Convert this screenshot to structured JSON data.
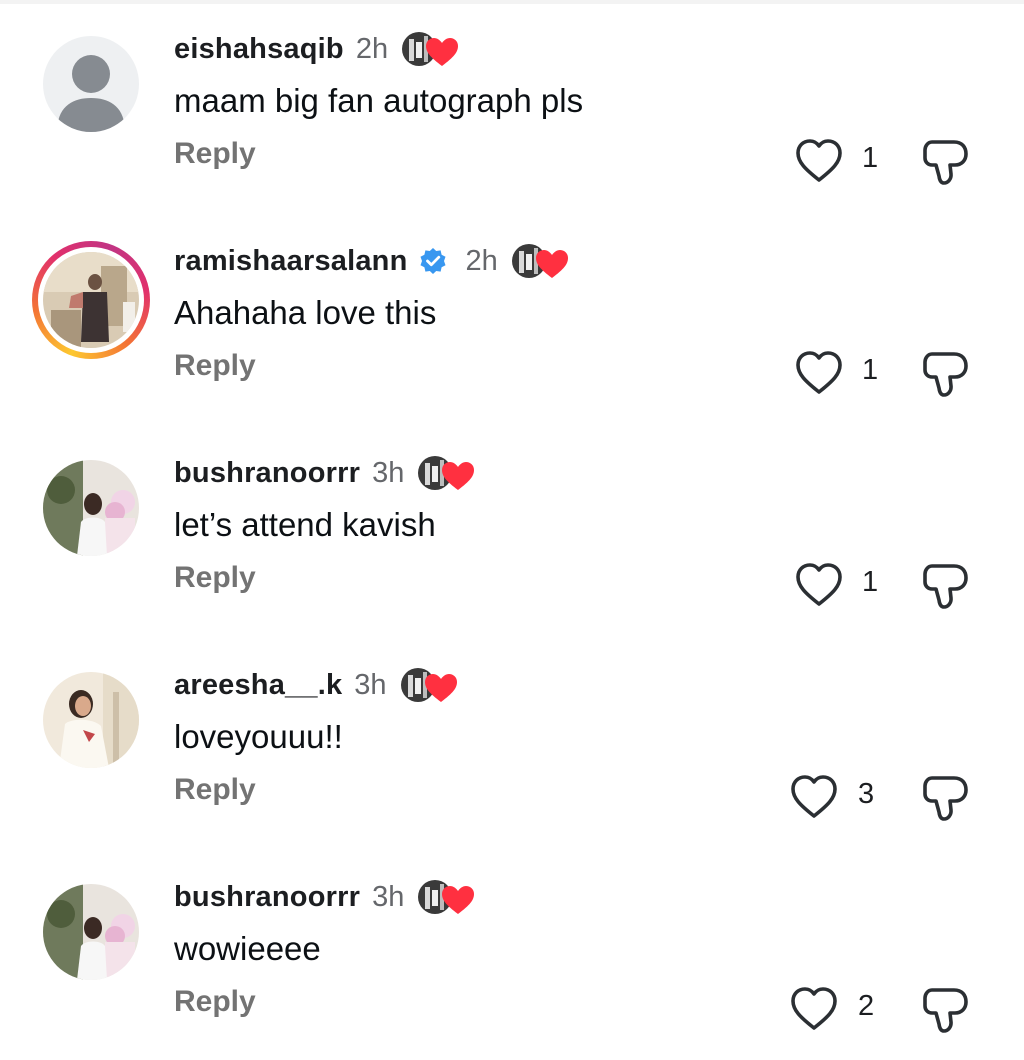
{
  "comments": [
    {
      "username": "eishahsaqib",
      "verified": false,
      "time": "2h",
      "text": "maam big fan autograph pls",
      "reply_label": "Reply",
      "likes": "1",
      "avatar": "default-avatar",
      "story_ring": false
    },
    {
      "username": "ramishaarsalann",
      "verified": true,
      "time": "2h",
      "text": "Ahahaha love this",
      "reply_label": "Reply",
      "likes": "1",
      "avatar": "photo-avatar",
      "story_ring": true
    },
    {
      "username": "bushranoorrr",
      "verified": false,
      "time": "3h",
      "text": "let’s attend kavish",
      "reply_label": "Reply",
      "likes": "1",
      "avatar": "photo-avatar",
      "story_ring": false
    },
    {
      "username": "areesha__.k",
      "verified": false,
      "time": "3h",
      "text": "loveyouuu!!",
      "reply_label": "Reply",
      "likes": "3",
      "avatar": "photo-avatar",
      "story_ring": false
    },
    {
      "username": "bushranoorrr",
      "verified": false,
      "time": "3h",
      "text": "wowieeee",
      "reply_label": "Reply",
      "likes": "2",
      "avatar": "photo-avatar",
      "story_ring": false
    }
  ],
  "icons": {
    "like": "heart-outline-icon",
    "dislike": "thumbs-down-outline-icon",
    "creator_liked": "creator-liked-heart-icon",
    "verified": "verified-badge-icon"
  },
  "colors": {
    "verified_blue": "#3897f0",
    "heart_red": "#ff3040",
    "secondary_text": "#737373",
    "timestamp_gray": "#65676b"
  }
}
